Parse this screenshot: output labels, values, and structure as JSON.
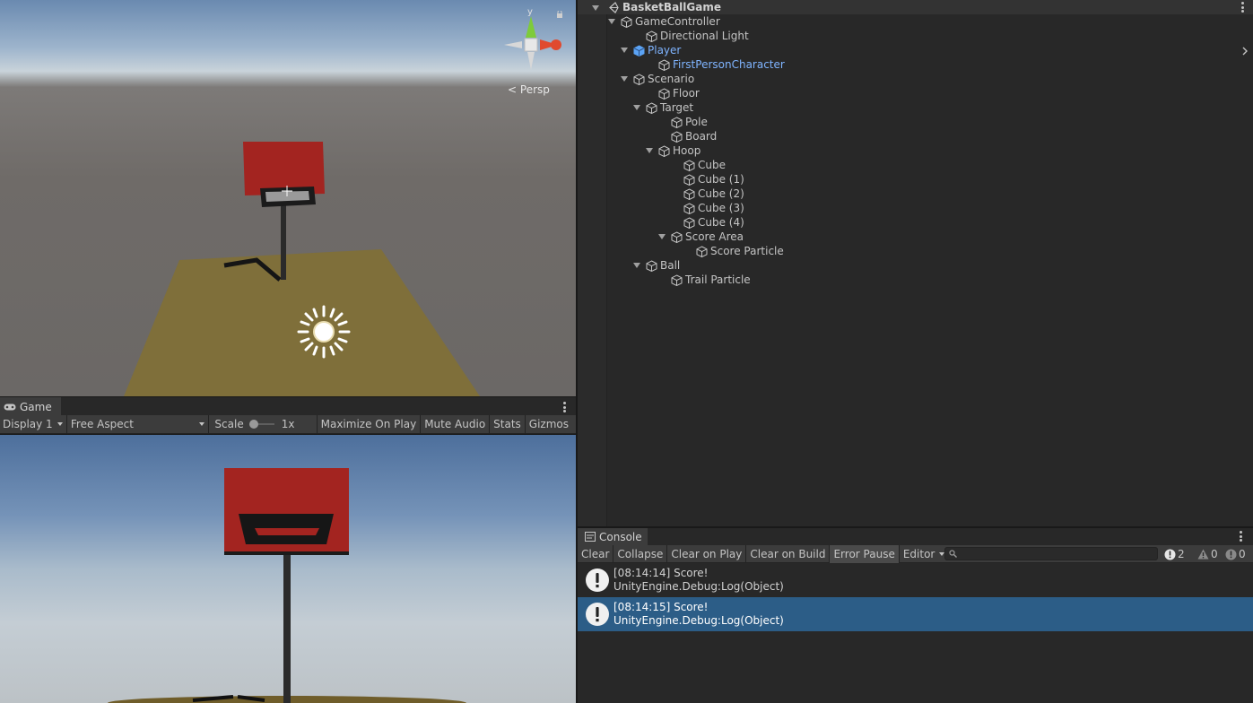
{
  "scene_view": {
    "projection_label": "Persp",
    "gizmo_axis_y": "y",
    "icons": [
      "scene-gizmo-icon",
      "lock-icon",
      "sun-light-icon"
    ]
  },
  "game_panel": {
    "tab_label": "Game",
    "toolbar": {
      "display": "Display 1",
      "aspect": "Free Aspect",
      "scale_label": "Scale",
      "scale_value": "1x",
      "maximize": "Maximize On Play",
      "mute": "Mute Audio",
      "stats": "Stats",
      "gizmos": "Gizmos"
    }
  },
  "hierarchy": {
    "scene_name": "BasketBallGame",
    "items": [
      {
        "label": "GameController",
        "depth": 0,
        "expanded": true,
        "prefab": false
      },
      {
        "label": "Directional Light",
        "depth": 1,
        "expanded": null,
        "prefab": false
      },
      {
        "label": "Player",
        "depth": 1,
        "expanded": true,
        "prefab": true
      },
      {
        "label": "FirstPersonCharacter",
        "depth": 2,
        "expanded": null,
        "prefab": true
      },
      {
        "label": "Scenario",
        "depth": 1,
        "expanded": true,
        "prefab": false
      },
      {
        "label": "Floor",
        "depth": 2,
        "expanded": null,
        "prefab": false
      },
      {
        "label": "Target",
        "depth": 2,
        "expanded": true,
        "prefab": false
      },
      {
        "label": "Pole",
        "depth": 3,
        "expanded": null,
        "prefab": false
      },
      {
        "label": "Board",
        "depth": 3,
        "expanded": null,
        "prefab": false
      },
      {
        "label": "Hoop",
        "depth": 3,
        "expanded": true,
        "prefab": false
      },
      {
        "label": "Cube",
        "depth": 4,
        "expanded": null,
        "prefab": false
      },
      {
        "label": "Cube (1)",
        "depth": 4,
        "expanded": null,
        "prefab": false
      },
      {
        "label": "Cube (2)",
        "depth": 4,
        "expanded": null,
        "prefab": false
      },
      {
        "label": "Cube (3)",
        "depth": 4,
        "expanded": null,
        "prefab": false
      },
      {
        "label": "Cube (4)",
        "depth": 4,
        "expanded": null,
        "prefab": false
      },
      {
        "label": "Score Area",
        "depth": 4,
        "expanded": true,
        "prefab": false
      },
      {
        "label": "Score Particle",
        "depth": 5,
        "expanded": null,
        "prefab": false
      },
      {
        "label": "Ball",
        "depth": 2,
        "expanded": true,
        "prefab": false
      },
      {
        "label": "Trail Particle",
        "depth": 3,
        "expanded": null,
        "prefab": false
      }
    ]
  },
  "console": {
    "tab_label": "Console",
    "toolbar": {
      "clear": "Clear",
      "collapse": "Collapse",
      "clear_on_play": "Clear on Play",
      "clear_on_build": "Clear on Build",
      "error_pause": "Error Pause",
      "editor": "Editor",
      "search_placeholder": ""
    },
    "counts": {
      "logs": "2",
      "warnings": "0",
      "errors": "0"
    },
    "entries": [
      {
        "line1": "[08:14:14] Score!",
        "line2": "UnityEngine.Debug:Log(Object)",
        "selected": false
      },
      {
        "line1": "[08:14:15] Score!",
        "line2": "UnityEngine.Debug:Log(Object)",
        "selected": true
      }
    ]
  },
  "colors": {
    "panel_bg": "#282828",
    "toolbar_bg": "#3c3c3c",
    "selection": "#2c5d87",
    "prefab_text": "#7fb4ff",
    "backboard_red": "#a32420",
    "floor_olive": "#7f6f3a"
  }
}
